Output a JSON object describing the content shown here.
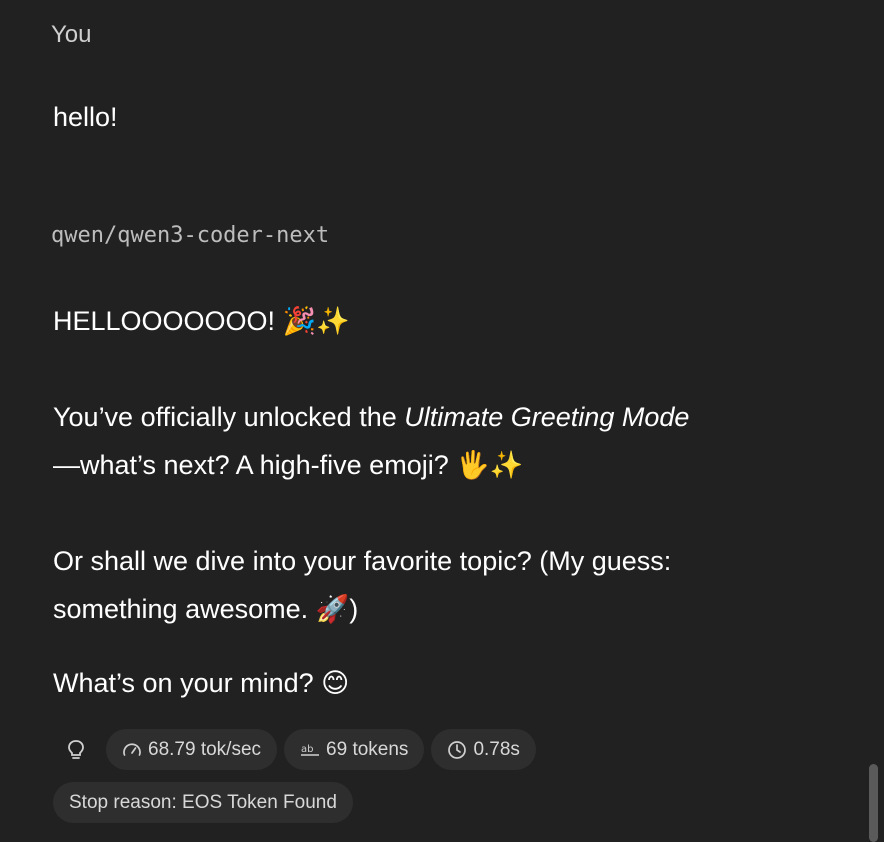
{
  "user": {
    "sender_label": "You",
    "message": "hello!"
  },
  "assistant": {
    "model_name": "qwen/qwen3-coder-next",
    "paragraph1_text": "HELLOOOOOOO! ",
    "paragraph1_emoji": "🎉✨",
    "paragraph2_line1_prefix": "You’ve officially unlocked the ",
    "paragraph2_line1_italic": "Ultimate Greeting Mode",
    "paragraph2_line2_text": "—what’s next? A high-five emoji? ",
    "paragraph2_line2_emoji": "🖐✨",
    "paragraph3_line1": "Or shall we dive into your favorite topic? (My guess:",
    "paragraph3_line2_text": "something awesome. ",
    "paragraph3_line2_emoji": "🚀",
    "paragraph3_line2_end": ")",
    "paragraph4_text": "What’s on your mind? ",
    "paragraph4_emoji": "😊"
  },
  "stats": {
    "speed": "68.79 tok/sec",
    "tokens": "69 tokens",
    "time": "0.78s",
    "stop_reason": "Stop reason: EOS Token Found"
  },
  "icons": {
    "bulb": "lightbulb-icon",
    "speed": "speedometer-icon",
    "tokens": "tokens-icon",
    "time": "clock-icon"
  }
}
